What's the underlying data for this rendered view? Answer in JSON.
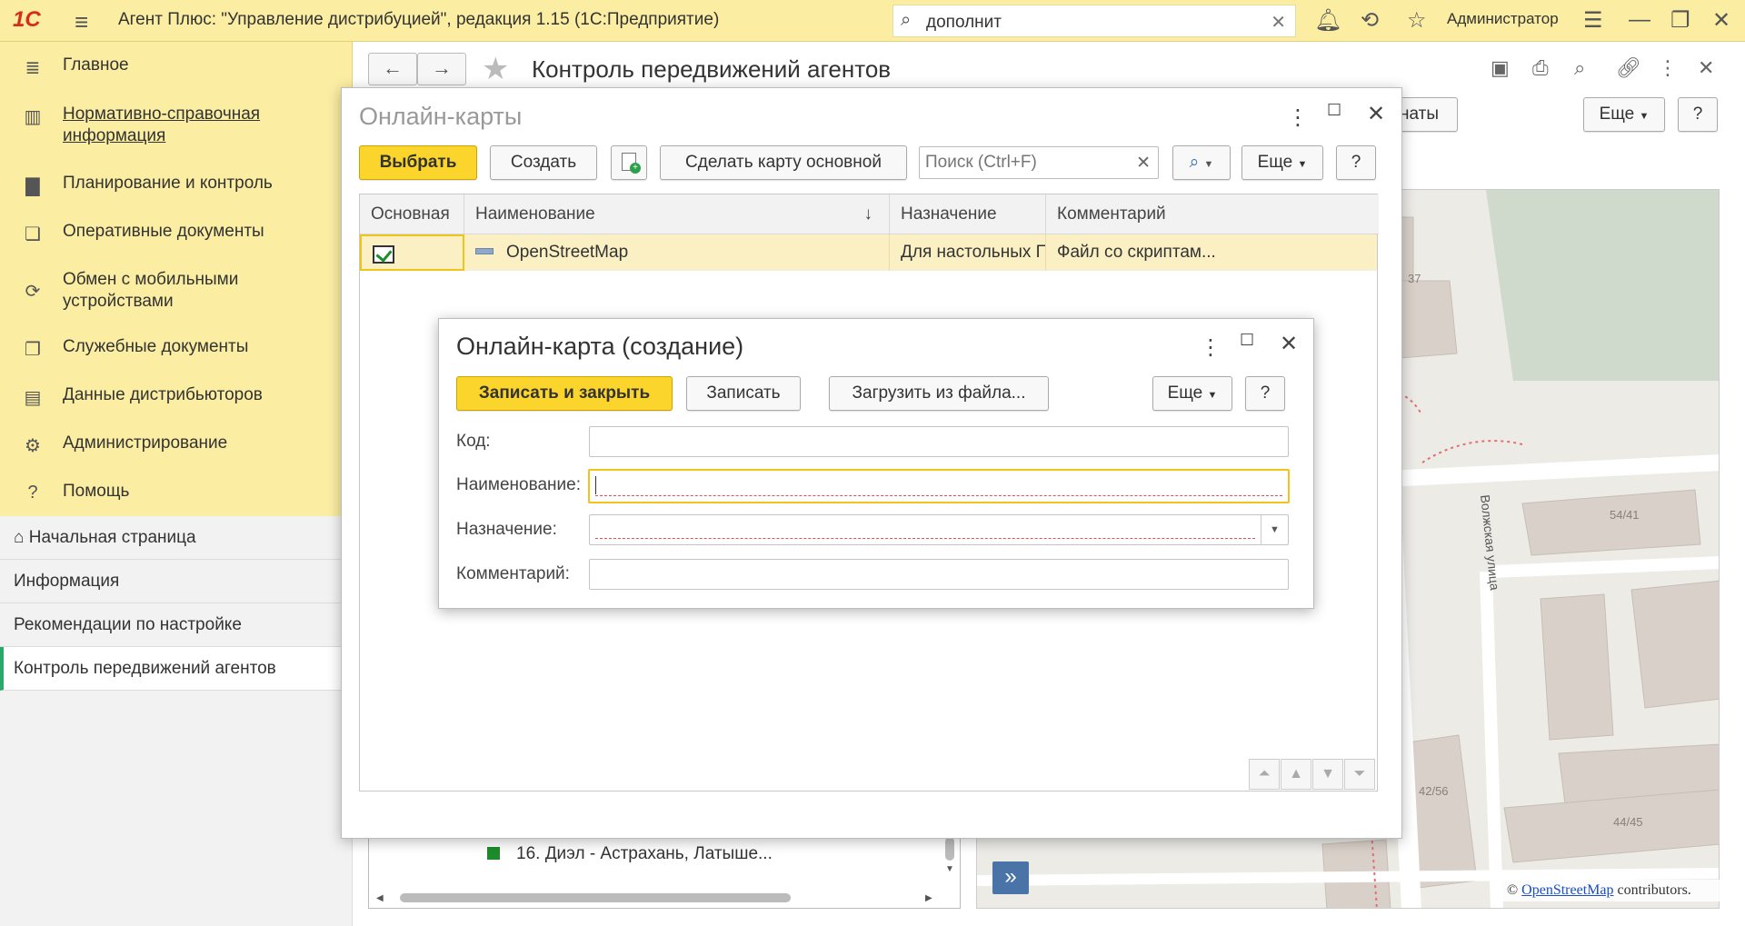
{
  "app": {
    "logo": "1С",
    "title": "Агент Плюс: \"Управление дистрибуцией\", редакция 1.15  (1С:Предприятие)",
    "search_value": "дополнит",
    "user": "Администратор"
  },
  "sidebar": {
    "sections": [
      {
        "label": "Главное",
        "icon": "menu-lines-icon"
      },
      {
        "label": "Нормативно-справочная информация",
        "icon": "reference-books-icon"
      },
      {
        "label": "Планирование и контроль",
        "icon": "bar-chart-icon"
      },
      {
        "label": "Оперативные документы",
        "icon": "documents-icon"
      },
      {
        "label": "Обмен с мобильными устройствами",
        "icon": "sync-icon"
      },
      {
        "label": "Служебные документы",
        "icon": "service-docs-icon"
      },
      {
        "label": "Данные дистрибьюторов",
        "icon": "distributor-data-icon"
      },
      {
        "label": "Администрирование",
        "icon": "gear-icon"
      },
      {
        "label": "Помощь",
        "icon": "help-icon"
      }
    ],
    "open_windows": [
      {
        "label": "Начальная страница",
        "icon": "home-icon"
      },
      {
        "label": "Информация"
      },
      {
        "label": "Рекомендации по настройке"
      },
      {
        "label": "Контроль передвижений агентов"
      }
    ]
  },
  "main": {
    "title": "Контроль передвижений агентов",
    "btn_partial": "наты",
    "btn_more": "Еще",
    "btn_help": "?",
    "agent_row": "16. Диэл  -  Астрахань, Латыше...",
    "map_labels": [
      "37",
      "54/41",
      "42/56",
      "44/45",
      "Волжская улица"
    ],
    "map_expand": "»",
    "osm_attribution": {
      "prefix": "©",
      "link": "OpenStreetMap",
      "suffix": "contributors."
    }
  },
  "online_maps": {
    "title": "Онлайн-карты",
    "buttons": {
      "select": "Выбрать",
      "create": "Создать",
      "make_default": "Сделать карту основной",
      "more": "Еще",
      "help": "?"
    },
    "search_placeholder": "Поиск (Ctrl+F)",
    "columns": [
      "Основная",
      "Наименование",
      "Назначение",
      "Комментарий"
    ],
    "sort_indicator": "↓",
    "rows": [
      {
        "is_default": true,
        "name": "OpenStreetMap",
        "purpose": "Для настольных ПК",
        "comment": "Файл со скриптам..."
      }
    ]
  },
  "create_dialog": {
    "title": "Онлайн-карта (создание)",
    "buttons": {
      "save_close": "Записать и закрыть",
      "save": "Записать",
      "load_file": "Загрузить из файла...",
      "more": "Еще",
      "help": "?"
    },
    "fields": [
      {
        "label": "Код:",
        "value": ""
      },
      {
        "label": "Наименование:",
        "value": ""
      },
      {
        "label": "Назначение:",
        "value": ""
      },
      {
        "label": "Комментарий:",
        "value": ""
      }
    ]
  },
  "colors": {
    "panel_yellow": "#fbeda2",
    "accent_button": "#fbd52c",
    "row_highlight": "#fbf0c4",
    "brand_red": "#d62c1a",
    "active_marker": "#2aa96a"
  }
}
